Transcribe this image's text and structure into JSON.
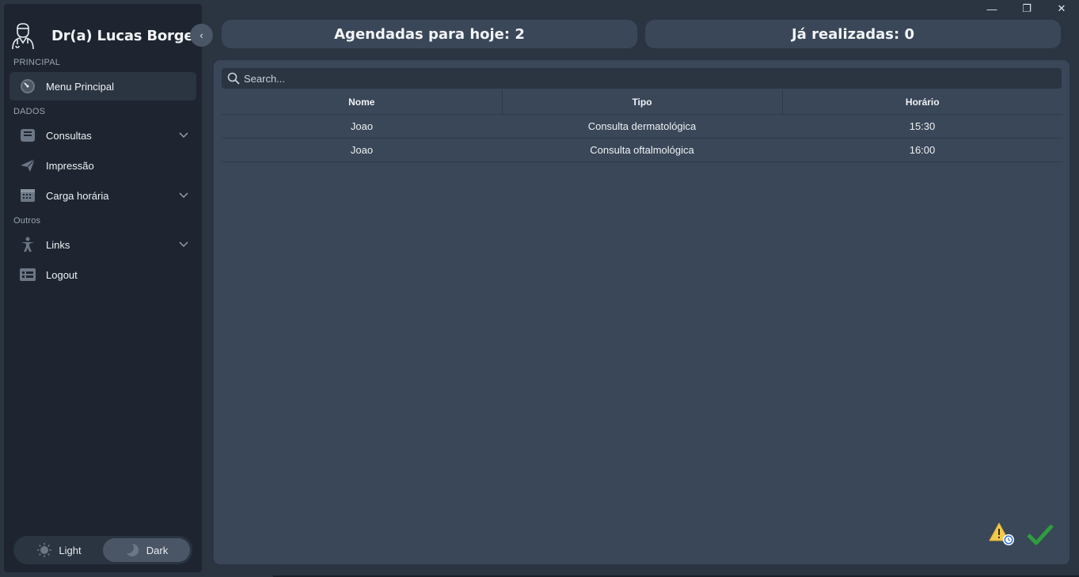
{
  "window": {
    "minimize_label": "—",
    "restore_label": "❐",
    "close_label": "✕"
  },
  "sidebar": {
    "user_name": "Dr(a) Lucas Borges",
    "collapse_label": "‹",
    "sections": {
      "principal": "PRINCIPAL",
      "dados": "DADOS",
      "outros": "Outros"
    },
    "items": [
      {
        "label": "Menu Principal",
        "icon": "dashboard-gauge-icon"
      },
      {
        "label": "Consultas",
        "icon": "inbox-tray-icon"
      },
      {
        "label": "Impressão",
        "icon": "paper-plane-icon"
      },
      {
        "label": "Carga horária",
        "icon": "calendar-grid-icon"
      },
      {
        "label": "Links",
        "icon": "person-figure-icon"
      },
      {
        "label": "Logout",
        "icon": "list-card-icon"
      }
    ],
    "theme": {
      "light_label": "Light",
      "dark_label": "Dark",
      "selected": "Dark"
    }
  },
  "stats": {
    "scheduled_today": "Agendadas para hoje: 2",
    "completed": "Já realizadas: 0"
  },
  "search": {
    "placeholder": "Search..."
  },
  "table": {
    "headers": [
      "Nome",
      "Tipo",
      "Horário"
    ],
    "rows": [
      [
        "Joao",
        "Consulta dermatológica",
        "15:30"
      ],
      [
        "Joao",
        "Consulta oftalmológica",
        "16:00"
      ]
    ]
  },
  "colors": {
    "background": "#2b3441",
    "sidebar": "#1e2530",
    "panel": "#3a4758",
    "warning": "#f2c94c",
    "success": "#2e9d3f"
  }
}
